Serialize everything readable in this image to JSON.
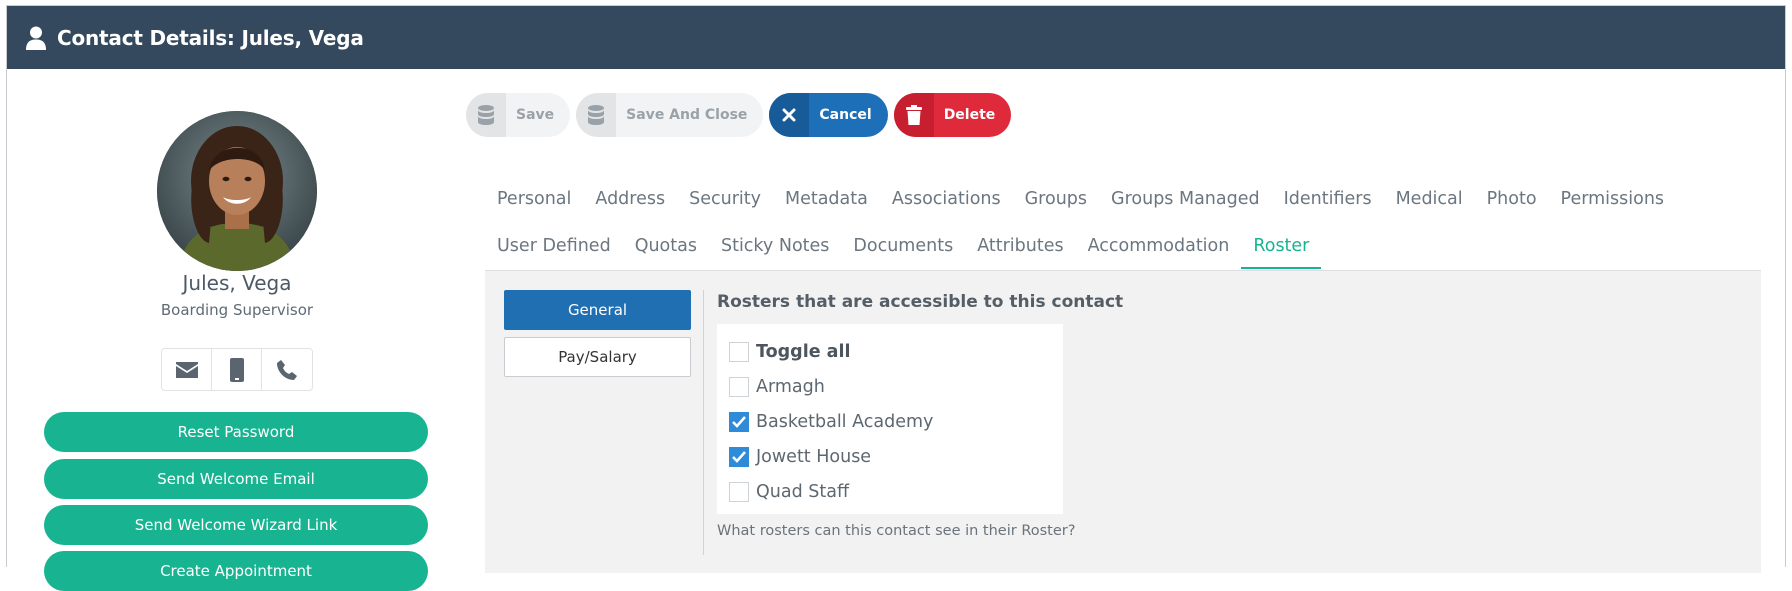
{
  "window": {
    "title": "Contact Details: Jules, Vega",
    "icon": "user-icon"
  },
  "profile": {
    "name": "Jules, Vega",
    "role": "Boarding Supervisor",
    "contact_icons": [
      "envelope-icon",
      "mobile-icon",
      "phone-icon"
    ],
    "buttons": [
      "Reset Password",
      "Send Welcome Email",
      "Send Welcome Wizard Link",
      "Create Appointment"
    ]
  },
  "toolbar": {
    "save": "Save",
    "save_close": "Save And Close",
    "cancel": "Cancel",
    "delete": "Delete"
  },
  "tabs": {
    "row1": [
      "Personal",
      "Address",
      "Security",
      "Metadata",
      "Associations",
      "Groups",
      "Groups Managed",
      "Identifiers",
      "Medical",
      "Photo",
      "Permissions"
    ],
    "row2": [
      "User Defined",
      "Quotas",
      "Sticky Notes",
      "Documents",
      "Attributes",
      "Accommodation",
      "Roster"
    ],
    "active": "Roster"
  },
  "roster": {
    "side_tabs": {
      "general": "General",
      "pay": "Pay/Salary"
    },
    "title": "Rosters that are accessible to this contact",
    "toggle_all": "Toggle all",
    "items": [
      {
        "label": "Armagh",
        "checked": false
      },
      {
        "label": "Basketball Academy",
        "checked": true
      },
      {
        "label": "Jowett House",
        "checked": true
      },
      {
        "label": "Quad Staff",
        "checked": false
      }
    ],
    "help": "What rosters can this contact see in their Roster?"
  },
  "colors": {
    "header": "#34495e",
    "accent_green": "#18b391",
    "primary": "#1f6fb2",
    "danger": "#df2a3c"
  }
}
